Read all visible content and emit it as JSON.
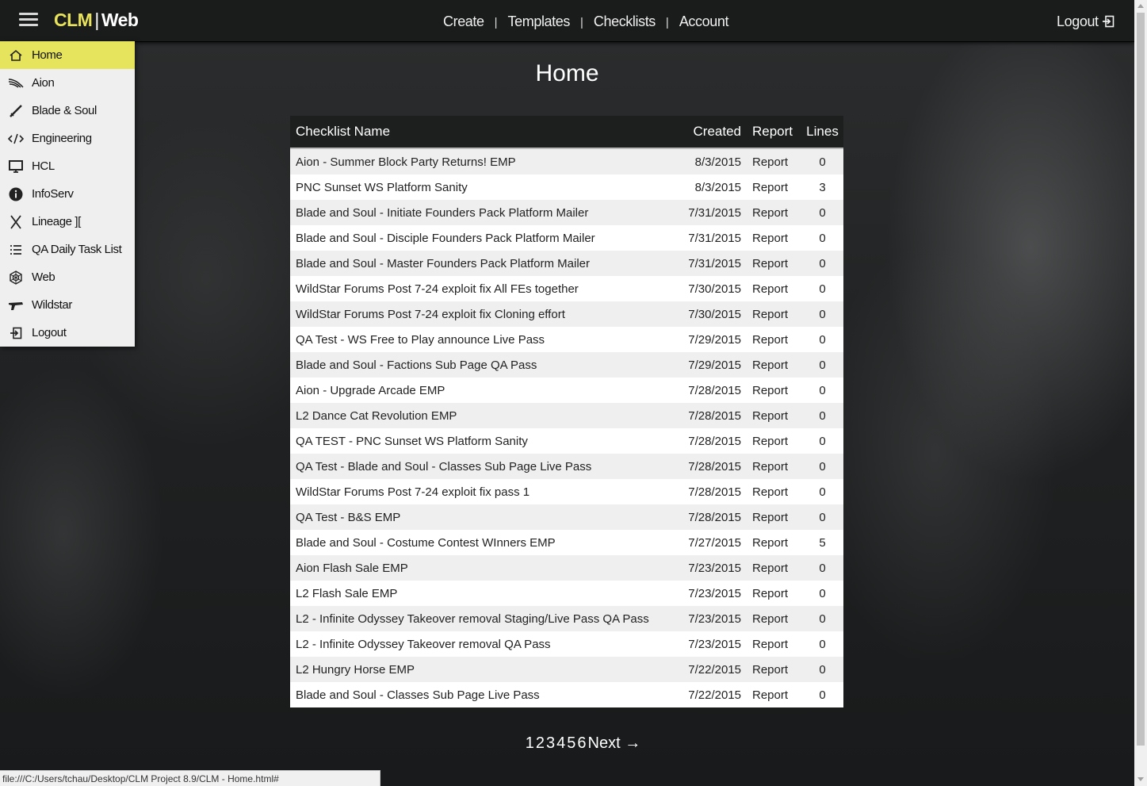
{
  "app": {
    "logo_brand": "CLM",
    "logo_sep": "|",
    "logo_product": "Web"
  },
  "topnav": [
    {
      "label": "Create"
    },
    {
      "label": "Templates"
    },
    {
      "label": "Checklists"
    },
    {
      "label": "Account"
    }
  ],
  "topnav_separator": "|",
  "logout_label": "Logout",
  "sidebar": {
    "items": [
      {
        "label": "Home",
        "icon": "home-icon",
        "active": true
      },
      {
        "label": "Aion",
        "icon": "wing-icon"
      },
      {
        "label": "Blade & Soul",
        "icon": "sword-icon"
      },
      {
        "label": "Engineering",
        "icon": "code-icon"
      },
      {
        "label": "HCL",
        "icon": "monitor-icon"
      },
      {
        "label": "InfoServ",
        "icon": "info-icon"
      },
      {
        "label": "Lineage ][",
        "icon": "cross-blades-icon"
      },
      {
        "label": "QA Daily Task List",
        "icon": "list-icon"
      },
      {
        "label": "Web",
        "icon": "web-icon"
      },
      {
        "label": "Wildstar",
        "icon": "blaster-icon"
      },
      {
        "label": "Logout",
        "icon": "logout-icon"
      }
    ]
  },
  "page_title": "Home",
  "table": {
    "headers": {
      "name": "Checklist Name",
      "created": "Created",
      "report": "Report",
      "lines": "Lines"
    },
    "rows": [
      {
        "name": "Aion - Summer Block Party Returns! EMP",
        "created": "8/3/2015",
        "report": "Report",
        "lines": "0"
      },
      {
        "name": "PNC Sunset WS Platform Sanity",
        "created": "8/3/2015",
        "report": "Report",
        "lines": "3"
      },
      {
        "name": "Blade and Soul - Initiate Founders Pack Platform Mailer",
        "created": "7/31/2015",
        "report": "Report",
        "lines": "0"
      },
      {
        "name": "Blade and Soul - Disciple Founders Pack Platform Mailer",
        "created": "7/31/2015",
        "report": "Report",
        "lines": "0"
      },
      {
        "name": "Blade and Soul - Master Founders Pack Platform Mailer",
        "created": "7/31/2015",
        "report": "Report",
        "lines": "0"
      },
      {
        "name": "WildStar Forums Post 7-24 exploit fix All FEs together",
        "created": "7/30/2015",
        "report": "Report",
        "lines": "0"
      },
      {
        "name": "WildStar Forums Post 7-24 exploit fix Cloning effort",
        "created": "7/30/2015",
        "report": "Report",
        "lines": "0"
      },
      {
        "name": "QA Test - WS Free to Play announce Live Pass",
        "created": "7/29/2015",
        "report": "Report",
        "lines": "0"
      },
      {
        "name": "Blade and Soul - Factions Sub Page QA Pass",
        "created": "7/29/2015",
        "report": "Report",
        "lines": "0"
      },
      {
        "name": "Aion - Upgrade Arcade EMP",
        "created": "7/28/2015",
        "report": "Report",
        "lines": "0"
      },
      {
        "name": "L2 Dance Cat Revolution EMP",
        "created": "7/28/2015",
        "report": "Report",
        "lines": "0"
      },
      {
        "name": "QA TEST - PNC Sunset WS Platform Sanity",
        "created": "7/28/2015",
        "report": "Report",
        "lines": "0"
      },
      {
        "name": "QA Test - Blade and Soul - Classes Sub Page Live Pass",
        "created": "7/28/2015",
        "report": "Report",
        "lines": "0"
      },
      {
        "name": "WildStar Forums Post 7-24 exploit fix pass 1",
        "created": "7/28/2015",
        "report": "Report",
        "lines": "0"
      },
      {
        "name": "QA Test - B&S EMP",
        "created": "7/28/2015",
        "report": "Report",
        "lines": "0"
      },
      {
        "name": "Blade and Soul - Costume Contest WInners EMP",
        "created": "7/27/2015",
        "report": "Report",
        "lines": "5"
      },
      {
        "name": "Aion Flash Sale EMP",
        "created": "7/23/2015",
        "report": "Report",
        "lines": "0"
      },
      {
        "name": "L2 Flash Sale EMP",
        "created": "7/23/2015",
        "report": "Report",
        "lines": "0"
      },
      {
        "name": "L2 - Infinite Odyssey Takeover removal Staging/Live Pass QA Pass",
        "created": "7/23/2015",
        "report": "Report",
        "lines": "0"
      },
      {
        "name": "L2 - Infinite Odyssey Takeover removal QA Pass",
        "created": "7/23/2015",
        "report": "Report",
        "lines": "0"
      },
      {
        "name": "L2 Hungry Horse EMP",
        "created": "7/22/2015",
        "report": "Report",
        "lines": "0"
      },
      {
        "name": "Blade and Soul - Classes Sub Page Live Pass",
        "created": "7/22/2015",
        "report": "Report",
        "lines": "0"
      }
    ]
  },
  "pagination": {
    "pages": [
      "1",
      "2",
      "3",
      "4",
      "5",
      "6"
    ],
    "next_label": "Next →"
  },
  "status_url": "file:///C:/Users/tchau/Desktop/CLM Project 8.9/CLM - Home.html#",
  "colors": {
    "accent": "#e6e45c",
    "topbar": "#1a1b1b",
    "sidebar_bg": "#efefef"
  }
}
